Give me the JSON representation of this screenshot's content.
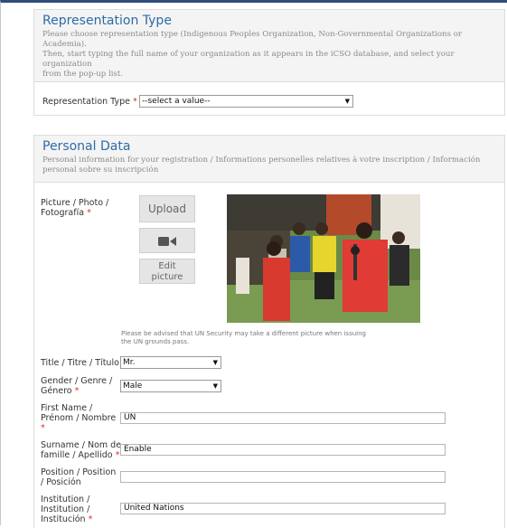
{
  "representation": {
    "title": "Representation Type",
    "desc_line1": "Please choose representation type (Indigenous Peoples Organization, Non-Governmental Organizations or",
    "desc_line2": "Academia).",
    "desc_line3": "Then, start typing the full name of your organization as it appears in the iCSO database, and select your organization",
    "desc_line4": "from the pop-up list.",
    "field_label": "Representation Type",
    "required_mark": "*",
    "select_value": "--select a value--"
  },
  "personal": {
    "title": "Personal Data",
    "desc_line1": "Personal information for your registration / Informations personelles relatives à votre inscription / Información",
    "desc_line2": "personal sobre su inscripción",
    "picture_label_l1": "Picture / Photo /",
    "picture_label_l2": "Fotografía",
    "upload_label": "Upload",
    "edit_label_l1": "Edit",
    "edit_label_l2": "picture",
    "note_l1": "Please be advised that UN Security may take a different picture when issuing",
    "note_l2": "the UN grounds pass.",
    "title_label": "Title / Titre / Título",
    "title_value": "Mr.",
    "gender_label_l1": "Gender / Genre /",
    "gender_label_l2": "Género",
    "gender_value": "Male",
    "first_label_l1": "First Name /",
    "first_label_l2": "Prénom / Nombre",
    "first_value": "UN",
    "surname_label_l1": "Surname / Nom de",
    "surname_label_l2": "famille / Apellido",
    "surname_value": "Enable",
    "position_label_l1": "Position / Position",
    "position_label_l2": "/ Posición",
    "position_value": "",
    "institution_label_l1": "Institution /",
    "institution_label_l2": "Institution /",
    "institution_label_l3": "Institución",
    "institution_value": "United Nations"
  },
  "icons": {
    "camera": "video-camera-icon",
    "dropdown": "chevron-down-icon"
  },
  "colors": {
    "accent": "#2e6aa8",
    "required": "#d9302c",
    "header_bar": "#2f4d7a"
  }
}
